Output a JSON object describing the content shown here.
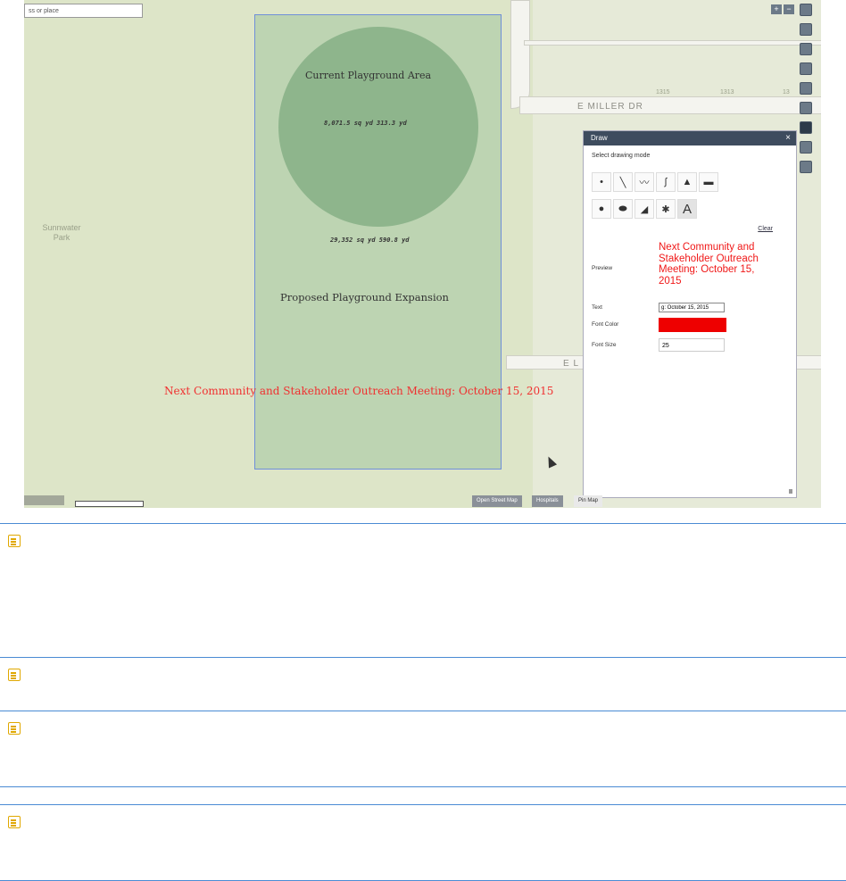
{
  "map": {
    "search_placeholder": "ss or place",
    "park_label": "Sunnwater Park",
    "street_miller": "E MILLER DR",
    "street_e": "E L",
    "house_numbers": [
      "1315",
      "1313",
      "13"
    ]
  },
  "drawings": {
    "circle_title": "Current Playground Area",
    "circle_measure": "8,071.5 sq yd 313.3 yd",
    "rect_measure": "29,352 sq yd 590.8 yd",
    "rect_title": "Proposed Playground Expansion",
    "annotation": "Next Community and Stakeholder Outreach Meeting: October 15, 2015",
    "annotation_color": "#f03030"
  },
  "draw_panel": {
    "title": "Draw",
    "subtitle": "Select drawing mode",
    "clear_label": "Clear",
    "preview_label": "Preview",
    "preview_text": "Next Community and Stakeholder Outreach Meeting: October 15, 2015",
    "text_label": "Text",
    "text_value": "g: October 15, 2015",
    "font_color_label": "Font Color",
    "font_color": "#ee0000",
    "font_size_label": "Font Size",
    "font_size_value": "25",
    "modes": [
      "point",
      "line",
      "polyline",
      "freehand-line",
      "triangle",
      "rectangle",
      "circle",
      "ellipse",
      "polygon",
      "freehand-polygon",
      "text"
    ]
  },
  "bottom_bar": {
    "buttons": [
      "Open Street Map",
      "Hospitals",
      "Pin Map"
    ]
  },
  "zoom": {
    "in": "+",
    "out": "−"
  }
}
